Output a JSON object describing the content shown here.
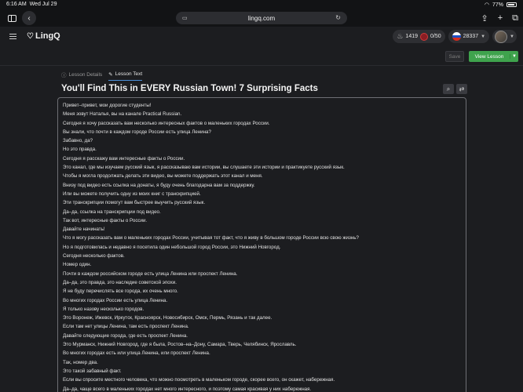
{
  "status": {
    "time": "6:16 AM",
    "date": "Wed Jul 29",
    "battery": "77%"
  },
  "browser": {
    "url": "lingq.com"
  },
  "header": {
    "logo": "LingQ",
    "streak": "1419",
    "daily_goal": "0/50",
    "known_words": "28337"
  },
  "toolbar": {
    "save_label": "Save",
    "view_label": "View Lesson"
  },
  "tabs": [
    {
      "label": "Lesson Details",
      "active": false
    },
    {
      "label": "Lesson Text",
      "active": true
    }
  ],
  "lesson": {
    "title": "You'll Find This in EVERY Russian Town! 7 Surprising Facts",
    "lines": [
      "Привет–привет, мои дорогие студенты!",
      "Меня зовут Наталья, вы на канале Practical Russian.",
      "Сегодня я хочу рассказать вам несколько интересных фактов о маленьких городах России.",
      "Вы знали, что почти в каждом городе России есть улица Ленина?",
      "Забавно, да?",
      "Но это правда.",
      "Сегодня я расскажу вам интересные факты о России.",
      "Это канал, где мы изучаем русский язык, я рассказываю вам истории, вы слушаете эти истории и практикуете русский язык.",
      "Чтобы я могла продолжать делать эти видео, вы можете поддержать этот канал и меня.",
      "Внизу под видео есть ссылка на донаты, я буду очень благодарна вам за поддержку.",
      "Или вы можете получить одну из моих книг с транскрипцией.",
      "Эти транскрипции помогут вам быстрее выучить русский язык.",
      "Да–да, ссылка на транскрипции под видео.",
      "Так вот, интересные факты о России.",
      "Давайте начинать!",
      "Что я могу рассказать вам о маленьких городах России, учитывая тот факт, что я живу в большом городе России всю свою жизнь?",
      "Но я подготовилась и недавно я посетила один небольшой город России, это Нижний Новгород.",
      "Сегодня несколько фактов.",
      "Номер один.",
      "Почти в каждом российском городе есть улица Ленина или проспект Ленина.",
      "Да–да, это правда, это наследие советской эпохи.",
      "Я не буду перечислять все города, их очень много.",
      "Во многих городах России есть улица Ленина.",
      "Я только назову несколько городов.",
      "Это Воронеж, Ижевск, Иркутск, Красноярск, Новосибирск, Омск, Пермь, Рязань и так далее.",
      "Если там нет улицы Ленина, там есть проспект Ленина.",
      "Давайте следующие города, где есть проспект Ленина.",
      "Это Мурманск, Нижний Новгород, где я была, Ростов–на–Дону, Самара, Тверь, Челябинск, Ярославль.",
      "Во многих городах есть или улица Ленина, или проспект Ленина.",
      "Так, номер два.",
      "Это такой забавный факт.",
      "Если вы спросите местного человека, что можно посмотреть в маленьком городе, скорее всего, он скажет, набережная.",
      "Да–да, чаще всего в маленьких городах нет много интересного, и поэтому самая красивая у них набережная."
    ]
  },
  "colors": {
    "accent_green": "#3fa34d",
    "tab_underline": "#4a8fd8",
    "background": "#1c1d20"
  }
}
